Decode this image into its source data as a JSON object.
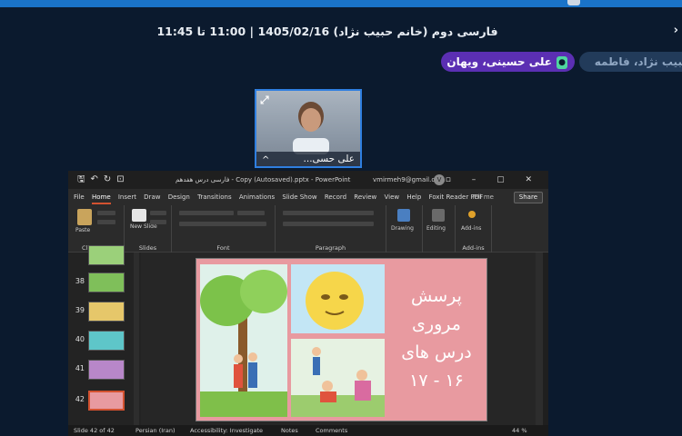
{
  "session": {
    "title": "فارسی دوم (خانم حبیب نژاد) 1405/02/16 | 11:00 تا 11:45",
    "nav_icon": "chevron-right-icon"
  },
  "participants": {
    "speaking_label": "علی حسینی، ویهان",
    "other_label": "حبیب نژاد، فاطمه",
    "mic_icon": "microphone-icon",
    "accent_color": "#5b2fb3"
  },
  "video": {
    "name": "علی حسی...",
    "caret": "^",
    "expand_icon": "expand-icon"
  },
  "ppt": {
    "file_title": "فارسی درس هفدهم - Copy (Autosaved).pptx - PowerPoint",
    "email": "vmirmeh9@gmail.com",
    "avatar": "V",
    "menu": [
      "File",
      "Home",
      "Insert",
      "Draw",
      "Design",
      "Transitions",
      "Animations",
      "Slide Show",
      "Record",
      "Review",
      "View",
      "Help",
      "Foxit Reader PDF"
    ],
    "active_menu": "Home",
    "tell_me": "Tell me",
    "share": "Share",
    "ribbon": {
      "paste": "Paste",
      "new_slide": "New Slide",
      "drawing": "Drawing",
      "editing": "Editing",
      "addins": "Add-ins",
      "groups": [
        "Clipboard",
        "Slides",
        "Font",
        "Paragraph",
        "Drawing",
        "Add-ins"
      ]
    },
    "thumbnails": [
      {
        "num": "38"
      },
      {
        "num": "39"
      },
      {
        "num": "40"
      },
      {
        "num": "41"
      },
      {
        "num": "42"
      }
    ],
    "slide_text": [
      "پرسش",
      "مروری",
      "درس های",
      "۱۶ - ۱۷"
    ],
    "status": {
      "slide_count": "Slide 42 of 42",
      "language": "Persian (Iran)",
      "accessibility": "Accessibility: Investigate",
      "notes": "Notes",
      "comments": "Comments",
      "zoom": "44 %"
    }
  }
}
